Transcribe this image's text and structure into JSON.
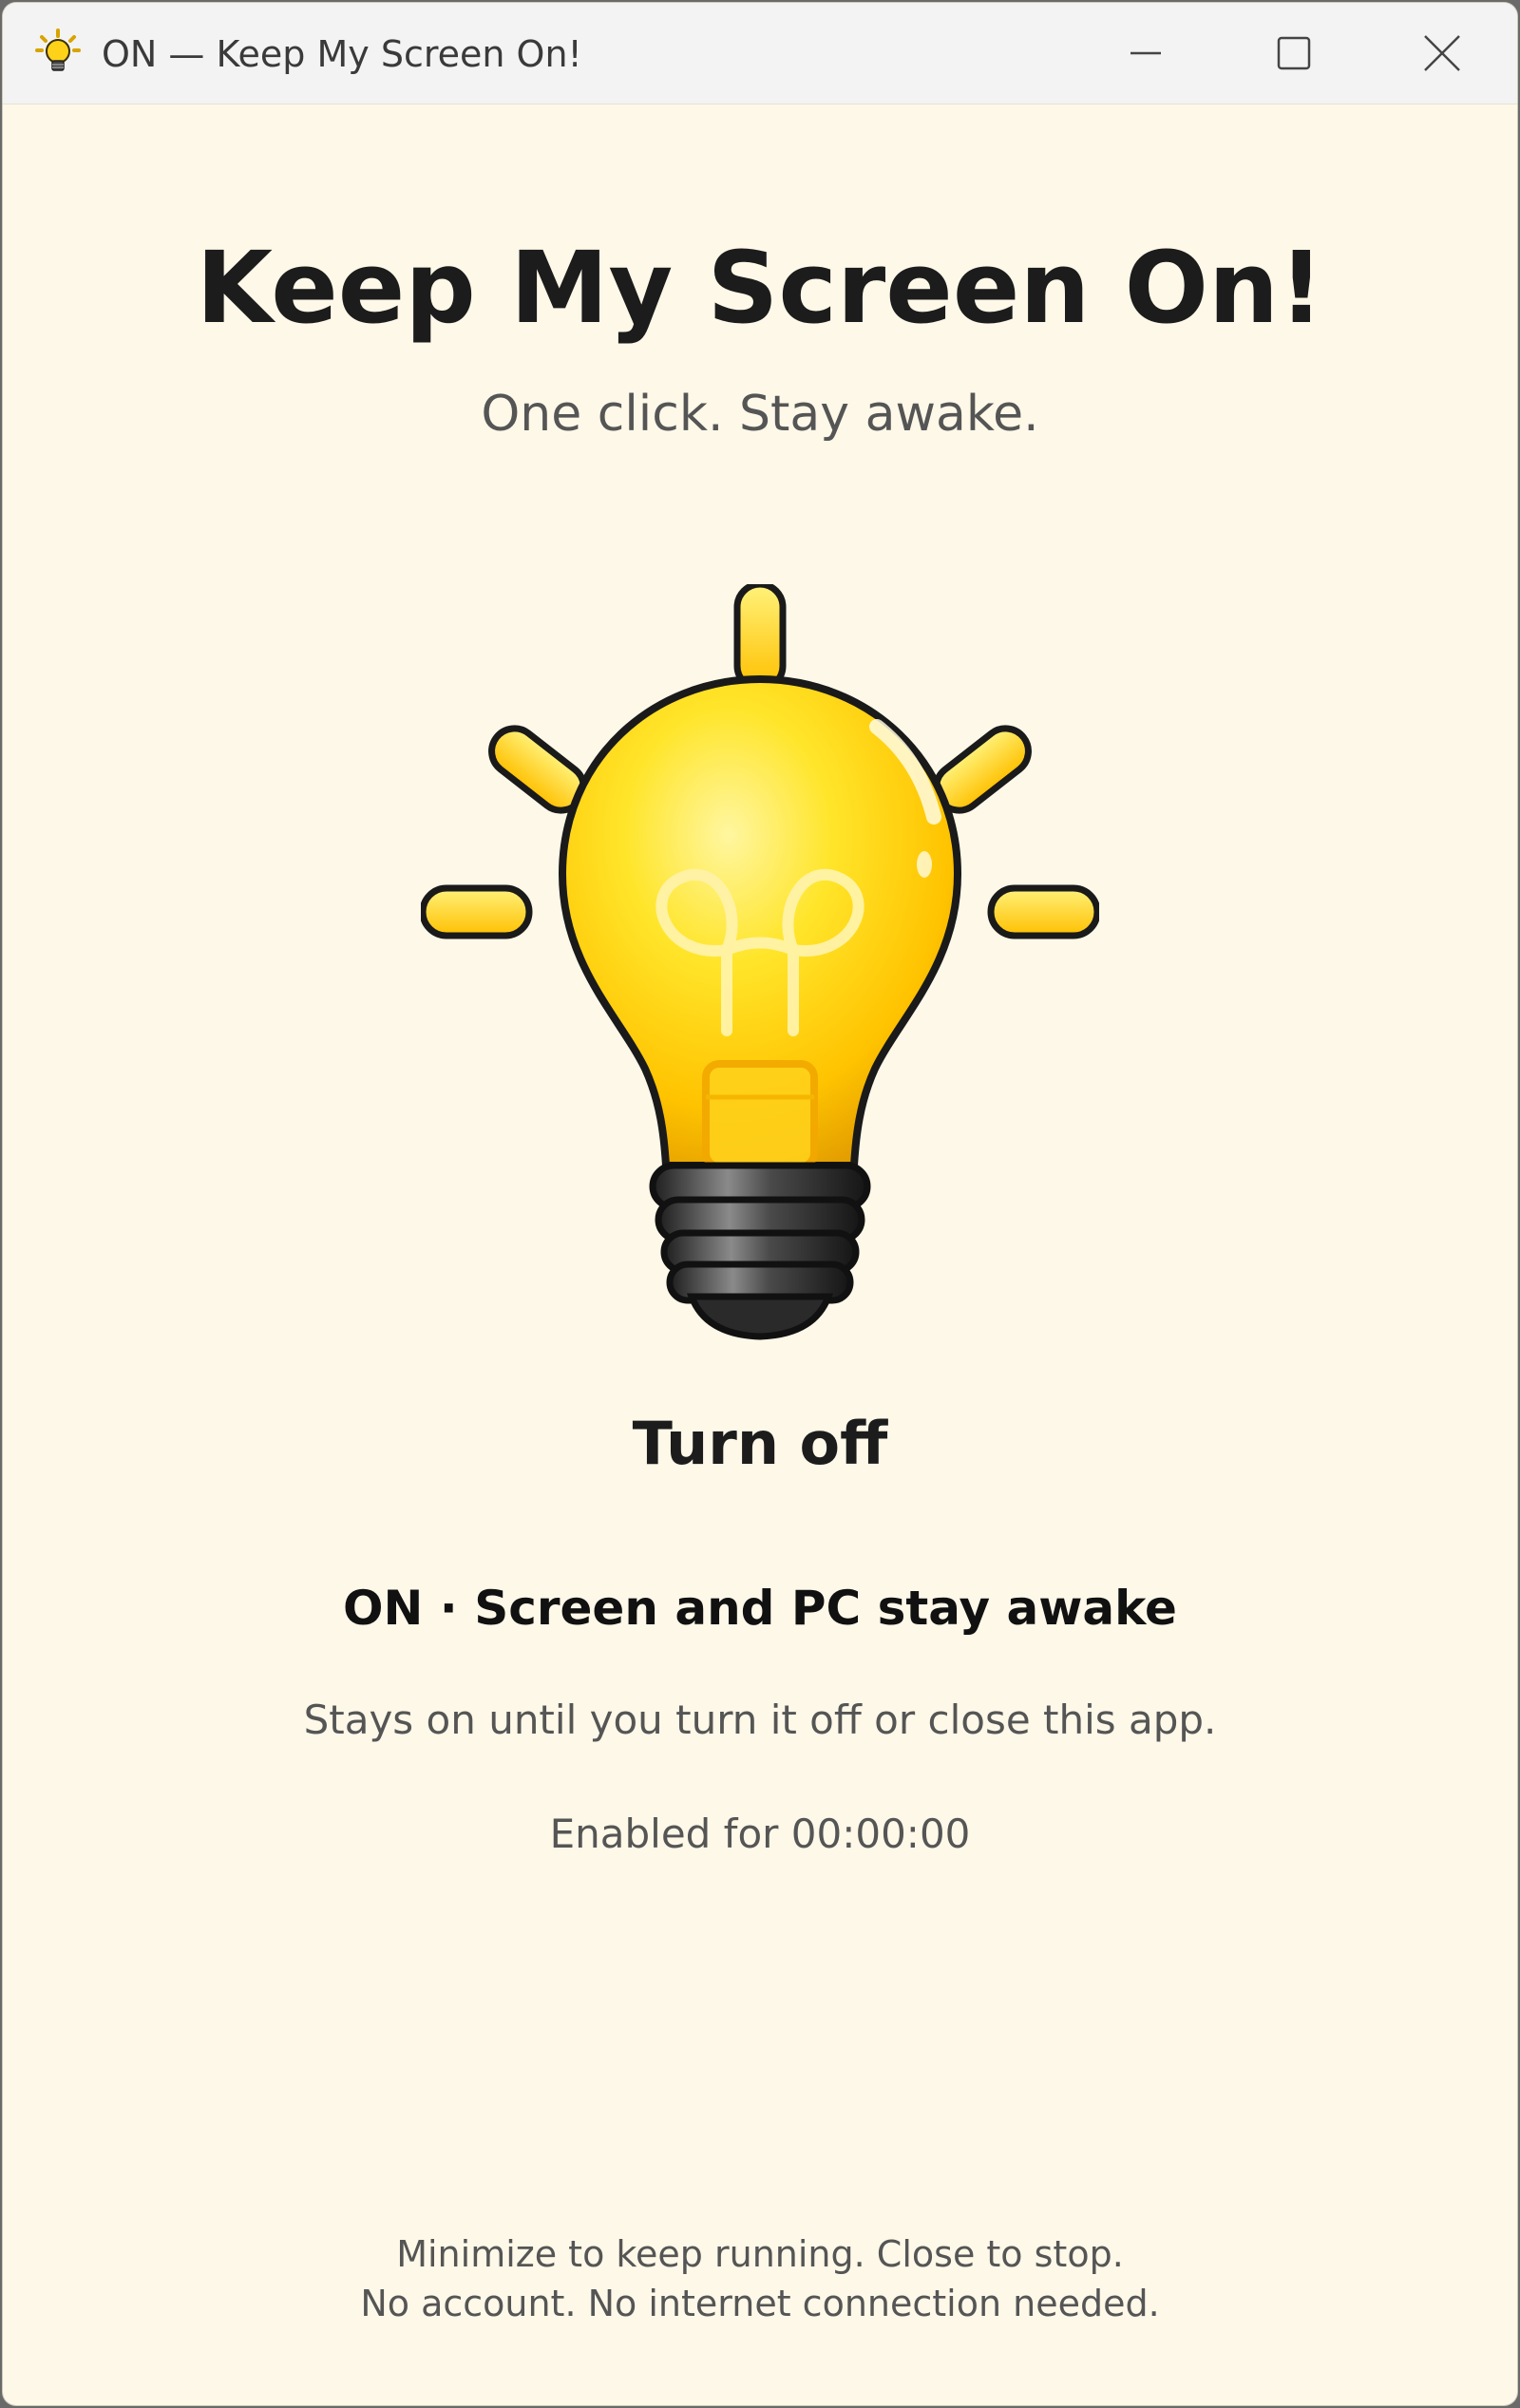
{
  "window": {
    "title": "ON — Keep My Screen On!",
    "app_icon": "lightbulb-icon",
    "controls": {
      "minimize_icon": "minimize-icon",
      "maximize_icon": "maximize-icon",
      "close_icon": "close-icon"
    }
  },
  "main": {
    "heading": "Keep My Screen On!",
    "tagline": "One click. Stay awake.",
    "bulb_icon": "lightbulb-on-icon",
    "toggle_label": "Turn off",
    "status": "ON · Screen and PC stay awake",
    "status_description": "Stays on until you turn it off or close this app.",
    "timer_text": "Enabled for 00:00:00"
  },
  "footer": {
    "line1": "Minimize to keep running. Close to stop.",
    "line2": "No account. No internet connection needed."
  },
  "colors": {
    "background": "#fdf8e8",
    "titlebar": "#f3f3f3",
    "bulb_yellow": "#ffd400",
    "text_dark": "#1c1c1c",
    "text_muted": "#555555"
  }
}
